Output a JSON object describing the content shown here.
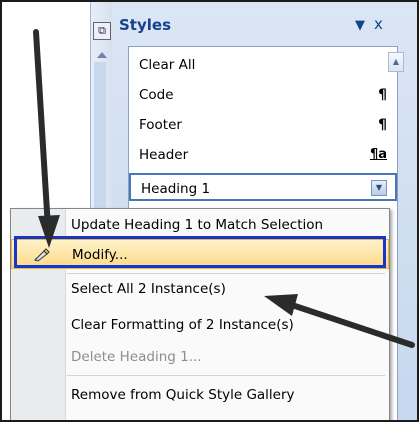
{
  "styles_pane": {
    "title": "Styles",
    "dropdown_glyph": "▼",
    "close_glyph": "x",
    "items": [
      {
        "label": "Clear All",
        "mark": ""
      },
      {
        "label": "Code",
        "mark": "¶"
      },
      {
        "label": "Footer",
        "mark": "¶"
      },
      {
        "label": "Header",
        "mark": "¶a"
      },
      {
        "label": "Heading 1",
        "mark": ""
      }
    ]
  },
  "context_menu": {
    "items": [
      {
        "label": "Update Heading 1 to Match Selection",
        "disabled": false
      },
      {
        "label": "Modify...",
        "disabled": false,
        "highlighted": true
      },
      {
        "label": "Select All 2 Instance(s)",
        "disabled": false
      },
      {
        "label": "Clear Formatting of 2 Instance(s)",
        "disabled": false
      },
      {
        "label": "Delete Heading 1...",
        "disabled": true
      },
      {
        "label": "Remove from Quick Style Gallery",
        "disabled": false
      }
    ]
  },
  "colors": {
    "pane_title": "#15428b",
    "highlight_border": "#1437c8",
    "menu_highlight": "#fcd987",
    "arrow": "#2b2b2b"
  }
}
